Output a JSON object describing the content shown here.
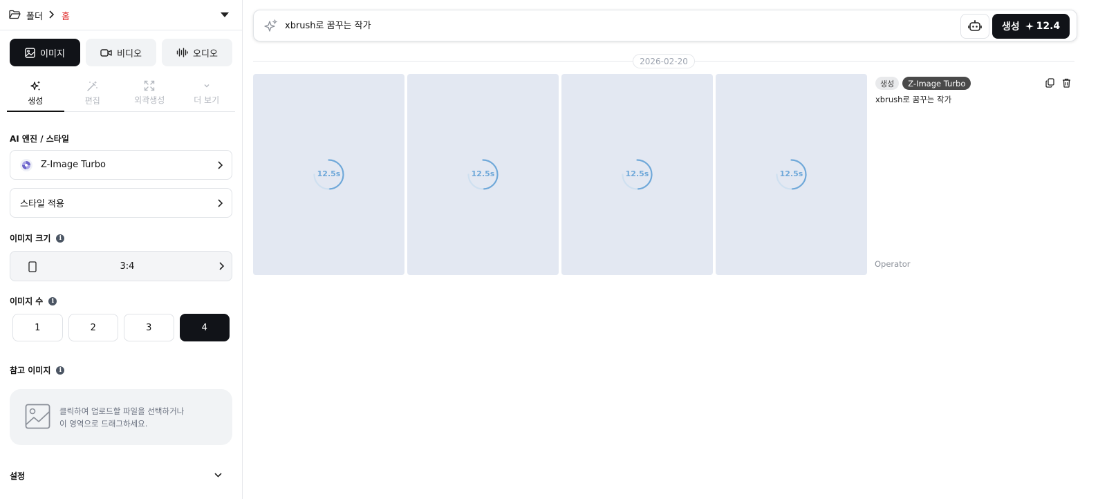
{
  "breadcrumb": {
    "folder": "폴더",
    "separator_icon": "chevron-right-icon",
    "current": "홈",
    "current_color": "#e03131"
  },
  "media_tabs": [
    {
      "label": "이미지",
      "icon": "image-icon",
      "active": true
    },
    {
      "label": "비디오",
      "icon": "video-icon",
      "active": false
    },
    {
      "label": "오디오",
      "icon": "audio-wave-icon",
      "active": false
    }
  ],
  "tool_tabs": [
    {
      "label": "생성",
      "icon": "sparkles-icon",
      "active": true
    },
    {
      "label": "편집",
      "icon": "magic-wand-icon",
      "active": false
    },
    {
      "label": "외곽생성",
      "icon": "expand-icon",
      "active": false
    },
    {
      "label": "더 보기",
      "icon": "chevron-down-icon",
      "active": false
    }
  ],
  "engine": {
    "section_label": "AI 엔진 / 스타일",
    "selected": "Z-Image Turbo",
    "style_label": "스타일 적용"
  },
  "image_size": {
    "label": "이미지 크기",
    "ratio": "3:4"
  },
  "image_count": {
    "label": "이미지 수",
    "options": [
      "1",
      "2",
      "3",
      "4"
    ],
    "selected": "4"
  },
  "reference": {
    "label": "참고 이미지",
    "line1": "클릭하여 업로드할 파일을 선택하거나",
    "line2": "이 영역으로 드래그하세요."
  },
  "settings": {
    "label": "설정"
  },
  "prompt": {
    "value": "xbrush로 꿈꾸는 작가"
  },
  "generate": {
    "label": "생성",
    "cost": "12.4"
  },
  "history": {
    "date": "2026-02-20",
    "items": [
      {
        "timer": "12.5s"
      },
      {
        "timer": "12.5s"
      },
      {
        "timer": "12.5s"
      },
      {
        "timer": "12.5s"
      }
    ],
    "tag_type": "생성",
    "tag_model": "Z-Image Turbo",
    "prompt": "xbrush로 꿈꾸는 작가",
    "user": "Operator"
  },
  "colors": {
    "accent": "#111318",
    "spinner": "#6fa8d9",
    "placeholder_bg": "#e3e8f2"
  }
}
